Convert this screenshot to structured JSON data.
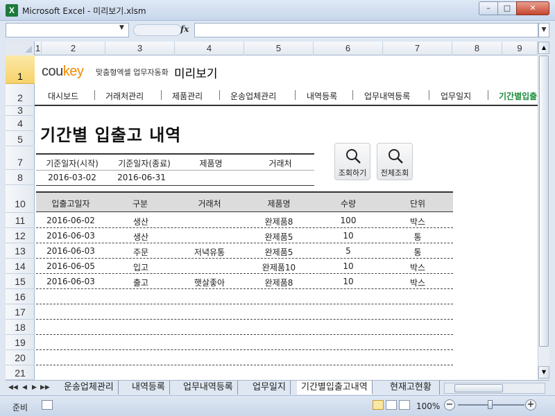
{
  "window": {
    "title": "Microsoft Excel - 미리보기.xlsm",
    "app_icon": "X",
    "min_label": "–",
    "max_label": "□",
    "close_label": "✕"
  },
  "formula_bar": {
    "name_box": "",
    "fx_label": "fx",
    "formula": ""
  },
  "columns": [
    "1",
    "2",
    "3",
    "4",
    "5",
    "6",
    "7",
    "8",
    "9"
  ],
  "rows": [
    "1",
    "2",
    "3",
    "4",
    "5",
    "7",
    "8",
    "10",
    "11",
    "12",
    "13",
    "14",
    "15",
    "16",
    "17",
    "18",
    "19",
    "20",
    "21"
  ],
  "selected_row": "1",
  "sheet": {
    "logo": {
      "part1": "cou",
      "part2": "key"
    },
    "tagline": "맞춤형엑셀 업무자동화",
    "heading": "미리보기",
    "nav": [
      "대시보드",
      "거래처관리",
      "제품관리",
      "운송업체관리",
      "내역등록",
      "업무내역등록",
      "업무일지",
      "기간별입출"
    ],
    "active_nav_index": 7,
    "title": "기간별 입출고 내역",
    "filter": {
      "headers": [
        "기준일자(시작)",
        "기준일자(종료)",
        "제품명",
        "거래처"
      ],
      "values": [
        "2016-03-02",
        "2016-06-31",
        "",
        ""
      ]
    },
    "buttons": {
      "search": "조회하기",
      "search_all": "전체조회"
    },
    "table": {
      "headers": [
        "입출고일자",
        "구분",
        "거래처",
        "제품명",
        "수량",
        "단위"
      ],
      "rows": [
        [
          "2016-06-02",
          "생산",
          "",
          "완제품8",
          "100",
          "박스"
        ],
        [
          "2016-06-03",
          "생산",
          "",
          "완제품5",
          "10",
          "통"
        ],
        [
          "2016-06-03",
          "주문",
          "저녁유통",
          "완제품5",
          "5",
          "통"
        ],
        [
          "2016-06-05",
          "입고",
          "",
          "완제품10",
          "10",
          "박스"
        ],
        [
          "2016-06-03",
          "출고",
          "햇살좋아",
          "완제품8",
          "10",
          "박스"
        ]
      ]
    }
  },
  "tabs": {
    "nav": [
      "◀◀",
      "◀",
      "▶",
      "▶▶"
    ],
    "sheets": [
      "운송업체관리",
      "내역등록",
      "업무내역등록",
      "업무일지",
      "기간별입출고내역",
      "현재고현황"
    ],
    "active_index": 4
  },
  "status": {
    "ready": "준비",
    "zoom": "100%",
    "zoom_minus": "−",
    "zoom_plus": "+"
  }
}
